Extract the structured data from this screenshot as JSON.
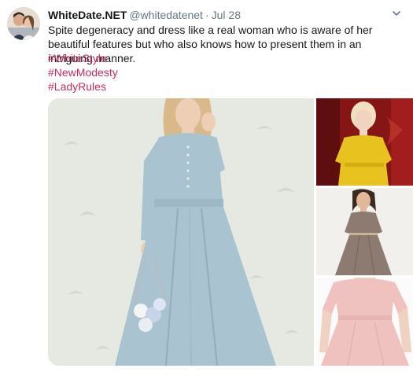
{
  "tweet": {
    "display_name": "WhiteDate.NET",
    "handle": "@whitedatenet",
    "separator": "·",
    "time": "Jul 28",
    "text": "Spite degeneracy and dress like a real woman who is aware of her beautiful features but who also knows how to present them in an intriguing manner.",
    "hashtags": [
      "#WhiteStyle",
      "#NewModesty",
      "#LadyRules"
    ]
  },
  "icons": {
    "caret": "chevron-down-icon"
  },
  "colors": {
    "hashtag": "#c52c5b",
    "secondary_text": "#657786",
    "primary_text": "#14171a"
  },
  "media": {
    "photos": [
      {
        "name": "light-blue-dress-photo"
      },
      {
        "name": "yellow-dress-photo"
      },
      {
        "name": "taupe-dress-photo"
      },
      {
        "name": "pink-dress-photo"
      }
    ]
  }
}
